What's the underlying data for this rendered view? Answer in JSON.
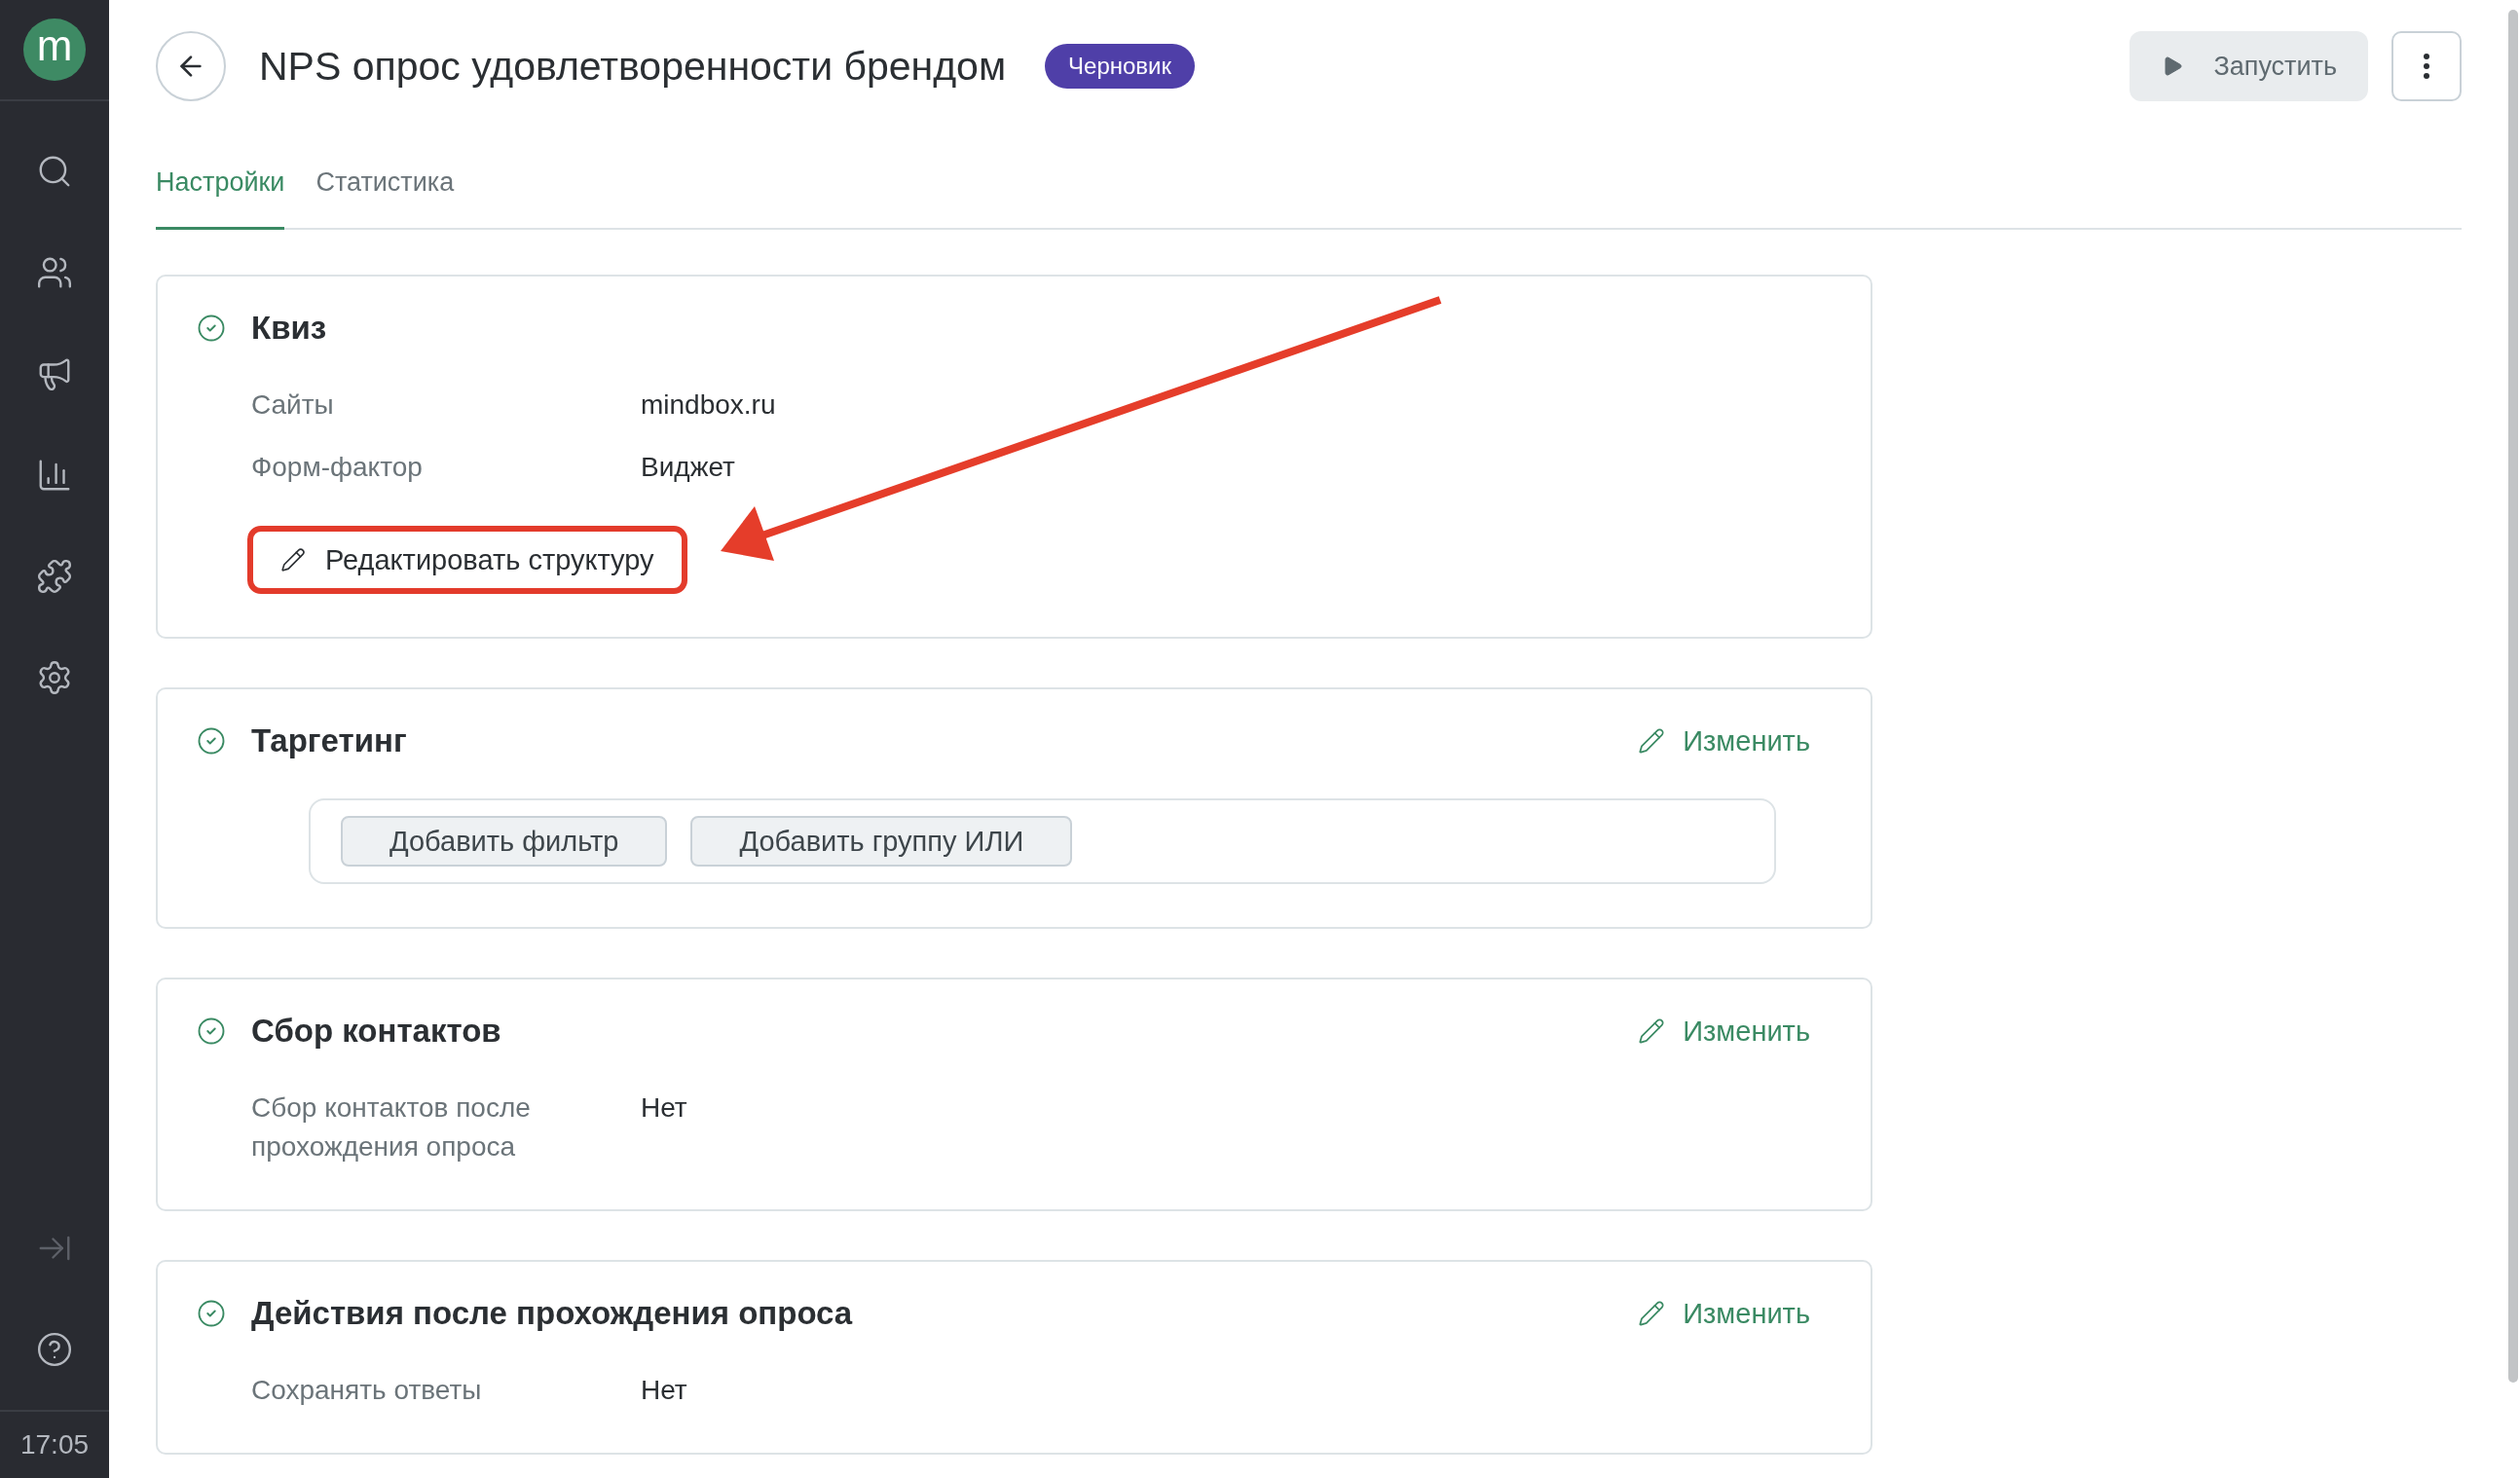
{
  "sidebar": {
    "logo": "m",
    "items": [
      {
        "kind": "search"
      },
      {
        "kind": "users"
      },
      {
        "kind": "megaphone"
      },
      {
        "kind": "chart"
      },
      {
        "kind": "puzzle"
      },
      {
        "kind": "settings"
      }
    ],
    "bottom_items": [
      {
        "kind": "expand"
      },
      {
        "kind": "help"
      }
    ],
    "time": "17:05"
  },
  "header": {
    "title": "NPS опрос удовлетворенности брендом",
    "badge": "Черновик",
    "run_button": "Запустить"
  },
  "tabs": [
    {
      "label": "Настройки",
      "selected": true
    },
    {
      "label": "Статистика",
      "selected": false
    }
  ],
  "cards": [
    {
      "title": "Квиз",
      "rows": [
        {
          "label": "Сайты",
          "value": "mindbox.ru"
        },
        {
          "label": "Форм-фактор",
          "value": "Виджет"
        }
      ],
      "edit_button": {
        "label": "Редактировать структуру",
        "highlighted": true
      }
    },
    {
      "title": "Таргетинг",
      "action": "Изменить",
      "filter_buttons": [
        "Добавить фильтр",
        "Добавить группу ИЛИ"
      ]
    },
    {
      "title": "Сбор контактов",
      "action": "Изменить",
      "rows": [
        {
          "label": "Сбор контактов после прохождения опроса",
          "value": "Нет"
        }
      ]
    },
    {
      "title": "Действия после прохождения опроса",
      "action": "Изменить",
      "rows": [
        {
          "label": "Сохранять ответы",
          "value": "Нет"
        }
      ]
    }
  ]
}
